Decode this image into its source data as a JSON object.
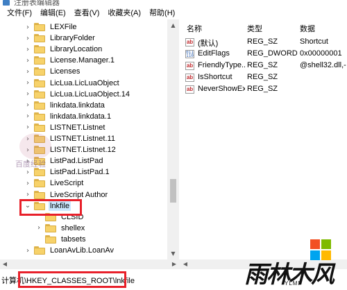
{
  "window": {
    "title": "注册表编辑器"
  },
  "menu": [
    "文件(F)",
    "编辑(E)",
    "查看(V)",
    "收藏夹(A)",
    "帮助(H)"
  ],
  "tree": {
    "items": [
      {
        "label": "LEXFile",
        "chev": "›"
      },
      {
        "label": "LibraryFolder",
        "chev": "›"
      },
      {
        "label": "LibraryLocation",
        "chev": "›"
      },
      {
        "label": "License.Manager.1",
        "chev": "›"
      },
      {
        "label": "Licenses",
        "chev": "›"
      },
      {
        "label": "LicLua.LicLuaObject",
        "chev": "›"
      },
      {
        "label": "LicLua.LicLuaObject.14",
        "chev": "›"
      },
      {
        "label": "linkdata.linkdata",
        "chev": "›"
      },
      {
        "label": "linkdata.linkdata.1",
        "chev": "›"
      },
      {
        "label": "LISTNET.Listnet",
        "chev": "›"
      },
      {
        "label": "LISTNET.Listnet.11",
        "chev": "›"
      },
      {
        "label": "LISTNET.Listnet.12",
        "chev": "›"
      },
      {
        "label": "ListPad.ListPad",
        "chev": "›"
      },
      {
        "label": "ListPad.ListPad.1",
        "chev": "›"
      },
      {
        "label": "LiveScript",
        "chev": "›"
      },
      {
        "label": "LiveScript Author",
        "chev": "›"
      },
      {
        "label": "lnkfile",
        "chev": "⌄",
        "selected": true
      },
      {
        "label": "CLSID",
        "chev": "",
        "child": true
      },
      {
        "label": "shellex",
        "chev": "›",
        "child": true
      },
      {
        "label": "tabsets",
        "chev": "",
        "child": true
      },
      {
        "label": "LoanAvLib.LoanAv",
        "chev": "›"
      }
    ]
  },
  "values": {
    "headers": {
      "name": "名称",
      "type": "类型",
      "data": "数据"
    },
    "rows": [
      {
        "icon": "string-value-icon",
        "name": "(默认)",
        "type": "REG_SZ",
        "data": "Shortcut"
      },
      {
        "icon": "binary-value-icon",
        "name": "EditFlags",
        "type": "REG_DWORD",
        "data": "0x00000001"
      },
      {
        "icon": "string-value-icon",
        "name": "FriendlyType...",
        "type": "REG_SZ",
        "data": "@shell32.dll,-"
      },
      {
        "icon": "string-value-icon",
        "name": "IsShortcut",
        "type": "REG_SZ",
        "data": ""
      },
      {
        "icon": "string-value-icon",
        "name": "NeverShowExt",
        "type": "REG_SZ",
        "data": ""
      }
    ]
  },
  "status": {
    "path": "计算机\\HKEY_CLASSES_ROOT\\lnkfile"
  },
  "watermarks": {
    "left_text": "百度经验",
    "brand_cn": "雨林木风",
    "brand_en": "YLMF"
  },
  "colors": {
    "highlight": "#e8202a",
    "selection": "#cce8ff",
    "folder": "#f7d26a"
  }
}
